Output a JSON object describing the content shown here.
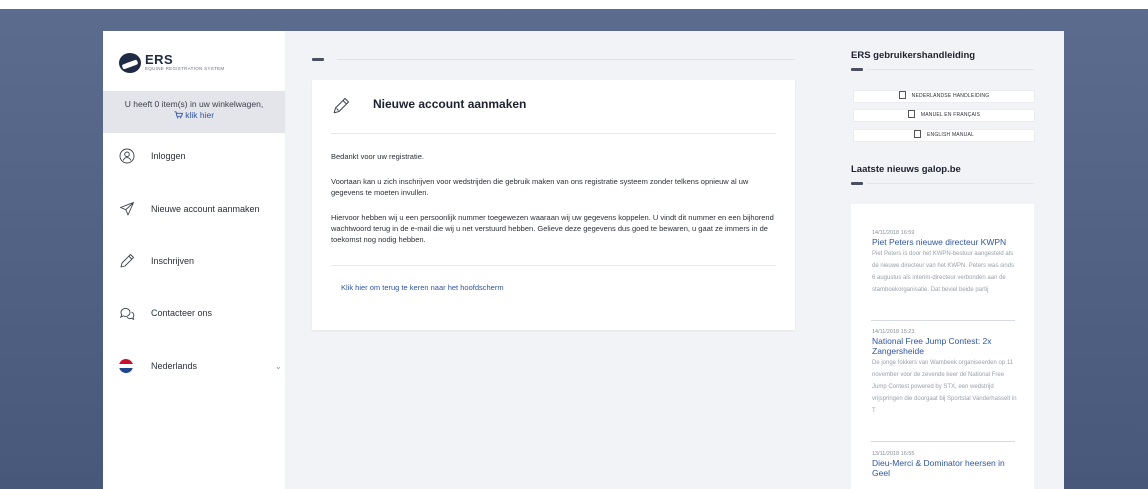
{
  "logo": {
    "title": "ERS",
    "subtitle": "EQUINE REGISTRATION SYSTEM"
  },
  "cart": {
    "text": "U heeft 0 item(s) in uw winkelwagen,",
    "link": "klik hier",
    "icon": "cart-icon"
  },
  "nav": {
    "items": [
      {
        "label": "Inloggen",
        "icon": "login-icon"
      },
      {
        "label": "Nieuwe account aanmaken",
        "icon": "send-icon"
      },
      {
        "label": "Inschrijven",
        "icon": "pencil-icon"
      },
      {
        "label": "Contacteer ons",
        "icon": "chat-icon"
      },
      {
        "label": "Nederlands",
        "icon": "flag-nl-icon"
      }
    ]
  },
  "card": {
    "title": "Nieuwe account aanmaken",
    "p1": "Bedankt voor uw registratie.",
    "p2": "Voortaan kan u zich inschrijven voor wedstrijden die gebruik maken van ons registratie systeem zonder telkens opnieuw al uw gegevens te moeten invullen.",
    "p3": "Hiervoor hebben wij u een persoonlijk nummer toegewezen waaraan wij uw gegevens koppelen. U vindt dit nummer en een bijhorend wachtwoord terug in de e-mail die wij u net verstuurd hebben. Gelieve deze gegevens dus goed te bewaren, u gaat ze immers in de toekomst nog nodig hebben.",
    "back_link": "Klik hier om terug te keren naar het hoofdscherm"
  },
  "manual": {
    "title": "ERS gebruikershandleiding",
    "buttons": [
      "NEDERLANDSE HANDLEIDING",
      "MANUEL EN FRANÇAIS",
      "ENGLISH MANUAL"
    ]
  },
  "news": {
    "title": "Laatste nieuws galop.be",
    "items": [
      {
        "date": "14/11/2018 16:59",
        "title": "Piet Peters nieuwe directeur KWPN",
        "body": "Piet Peters is door het KWPN-bestuur aangesteld als de nieuwe directeur van het KWPN. Peters was sinds 6 augustus als interim-directeur verbonden aan de stamboekorganisatie. Dat beviel beide partij"
      },
      {
        "date": "14/11/2018 15:23",
        "title": "National Free Jump Contest: 2x Zangersheide",
        "body": "De jonge fokkers van Wambeek organiseerden op 11 november voor de zevende keer de National Free Jump Contest powered by STX, een wedstrijd vrijspringen die doorgaat bij Sportstal Vanderhasselt in T"
      },
      {
        "date": "13/11/2018 16:55",
        "title": "Dieu-Merci & Dominator heersen in Geel",
        "body": ""
      }
    ]
  },
  "colors": {
    "link": "#2f55a4",
    "background": "#5c6c8f",
    "sidebar": "#ffffff",
    "content_bg": "#f2f3f7"
  }
}
